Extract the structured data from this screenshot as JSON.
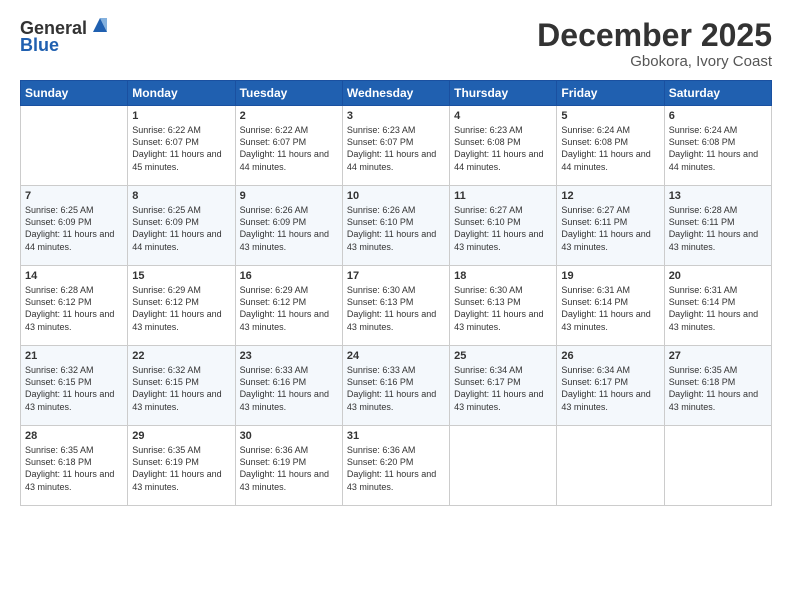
{
  "header": {
    "logo_line1": "General",
    "logo_line2": "Blue",
    "month_title": "December 2025",
    "location": "Gbokora, Ivory Coast"
  },
  "days_of_week": [
    "Sunday",
    "Monday",
    "Tuesday",
    "Wednesday",
    "Thursday",
    "Friday",
    "Saturday"
  ],
  "weeks": [
    [
      {
        "day": "",
        "sunrise": "",
        "sunset": "",
        "daylight": ""
      },
      {
        "day": "1",
        "sunrise": "Sunrise: 6:22 AM",
        "sunset": "Sunset: 6:07 PM",
        "daylight": "Daylight: 11 hours and 45 minutes."
      },
      {
        "day": "2",
        "sunrise": "Sunrise: 6:22 AM",
        "sunset": "Sunset: 6:07 PM",
        "daylight": "Daylight: 11 hours and 44 minutes."
      },
      {
        "day": "3",
        "sunrise": "Sunrise: 6:23 AM",
        "sunset": "Sunset: 6:07 PM",
        "daylight": "Daylight: 11 hours and 44 minutes."
      },
      {
        "day": "4",
        "sunrise": "Sunrise: 6:23 AM",
        "sunset": "Sunset: 6:08 PM",
        "daylight": "Daylight: 11 hours and 44 minutes."
      },
      {
        "day": "5",
        "sunrise": "Sunrise: 6:24 AM",
        "sunset": "Sunset: 6:08 PM",
        "daylight": "Daylight: 11 hours and 44 minutes."
      },
      {
        "day": "6",
        "sunrise": "Sunrise: 6:24 AM",
        "sunset": "Sunset: 6:08 PM",
        "daylight": "Daylight: 11 hours and 44 minutes."
      }
    ],
    [
      {
        "day": "7",
        "sunrise": "Sunrise: 6:25 AM",
        "sunset": "Sunset: 6:09 PM",
        "daylight": "Daylight: 11 hours and 44 minutes."
      },
      {
        "day": "8",
        "sunrise": "Sunrise: 6:25 AM",
        "sunset": "Sunset: 6:09 PM",
        "daylight": "Daylight: 11 hours and 44 minutes."
      },
      {
        "day": "9",
        "sunrise": "Sunrise: 6:26 AM",
        "sunset": "Sunset: 6:09 PM",
        "daylight": "Daylight: 11 hours and 43 minutes."
      },
      {
        "day": "10",
        "sunrise": "Sunrise: 6:26 AM",
        "sunset": "Sunset: 6:10 PM",
        "daylight": "Daylight: 11 hours and 43 minutes."
      },
      {
        "day": "11",
        "sunrise": "Sunrise: 6:27 AM",
        "sunset": "Sunset: 6:10 PM",
        "daylight": "Daylight: 11 hours and 43 minutes."
      },
      {
        "day": "12",
        "sunrise": "Sunrise: 6:27 AM",
        "sunset": "Sunset: 6:11 PM",
        "daylight": "Daylight: 11 hours and 43 minutes."
      },
      {
        "day": "13",
        "sunrise": "Sunrise: 6:28 AM",
        "sunset": "Sunset: 6:11 PM",
        "daylight": "Daylight: 11 hours and 43 minutes."
      }
    ],
    [
      {
        "day": "14",
        "sunrise": "Sunrise: 6:28 AM",
        "sunset": "Sunset: 6:12 PM",
        "daylight": "Daylight: 11 hours and 43 minutes."
      },
      {
        "day": "15",
        "sunrise": "Sunrise: 6:29 AM",
        "sunset": "Sunset: 6:12 PM",
        "daylight": "Daylight: 11 hours and 43 minutes."
      },
      {
        "day": "16",
        "sunrise": "Sunrise: 6:29 AM",
        "sunset": "Sunset: 6:12 PM",
        "daylight": "Daylight: 11 hours and 43 minutes."
      },
      {
        "day": "17",
        "sunrise": "Sunrise: 6:30 AM",
        "sunset": "Sunset: 6:13 PM",
        "daylight": "Daylight: 11 hours and 43 minutes."
      },
      {
        "day": "18",
        "sunrise": "Sunrise: 6:30 AM",
        "sunset": "Sunset: 6:13 PM",
        "daylight": "Daylight: 11 hours and 43 minutes."
      },
      {
        "day": "19",
        "sunrise": "Sunrise: 6:31 AM",
        "sunset": "Sunset: 6:14 PM",
        "daylight": "Daylight: 11 hours and 43 minutes."
      },
      {
        "day": "20",
        "sunrise": "Sunrise: 6:31 AM",
        "sunset": "Sunset: 6:14 PM",
        "daylight": "Daylight: 11 hours and 43 minutes."
      }
    ],
    [
      {
        "day": "21",
        "sunrise": "Sunrise: 6:32 AM",
        "sunset": "Sunset: 6:15 PM",
        "daylight": "Daylight: 11 hours and 43 minutes."
      },
      {
        "day": "22",
        "sunrise": "Sunrise: 6:32 AM",
        "sunset": "Sunset: 6:15 PM",
        "daylight": "Daylight: 11 hours and 43 minutes."
      },
      {
        "day": "23",
        "sunrise": "Sunrise: 6:33 AM",
        "sunset": "Sunset: 6:16 PM",
        "daylight": "Daylight: 11 hours and 43 minutes."
      },
      {
        "day": "24",
        "sunrise": "Sunrise: 6:33 AM",
        "sunset": "Sunset: 6:16 PM",
        "daylight": "Daylight: 11 hours and 43 minutes."
      },
      {
        "day": "25",
        "sunrise": "Sunrise: 6:34 AM",
        "sunset": "Sunset: 6:17 PM",
        "daylight": "Daylight: 11 hours and 43 minutes."
      },
      {
        "day": "26",
        "sunrise": "Sunrise: 6:34 AM",
        "sunset": "Sunset: 6:17 PM",
        "daylight": "Daylight: 11 hours and 43 minutes."
      },
      {
        "day": "27",
        "sunrise": "Sunrise: 6:35 AM",
        "sunset": "Sunset: 6:18 PM",
        "daylight": "Daylight: 11 hours and 43 minutes."
      }
    ],
    [
      {
        "day": "28",
        "sunrise": "Sunrise: 6:35 AM",
        "sunset": "Sunset: 6:18 PM",
        "daylight": "Daylight: 11 hours and 43 minutes."
      },
      {
        "day": "29",
        "sunrise": "Sunrise: 6:35 AM",
        "sunset": "Sunset: 6:19 PM",
        "daylight": "Daylight: 11 hours and 43 minutes."
      },
      {
        "day": "30",
        "sunrise": "Sunrise: 6:36 AM",
        "sunset": "Sunset: 6:19 PM",
        "daylight": "Daylight: 11 hours and 43 minutes."
      },
      {
        "day": "31",
        "sunrise": "Sunrise: 6:36 AM",
        "sunset": "Sunset: 6:20 PM",
        "daylight": "Daylight: 11 hours and 43 minutes."
      },
      {
        "day": "",
        "sunrise": "",
        "sunset": "",
        "daylight": ""
      },
      {
        "day": "",
        "sunrise": "",
        "sunset": "",
        "daylight": ""
      },
      {
        "day": "",
        "sunrise": "",
        "sunset": "",
        "daylight": ""
      }
    ]
  ]
}
